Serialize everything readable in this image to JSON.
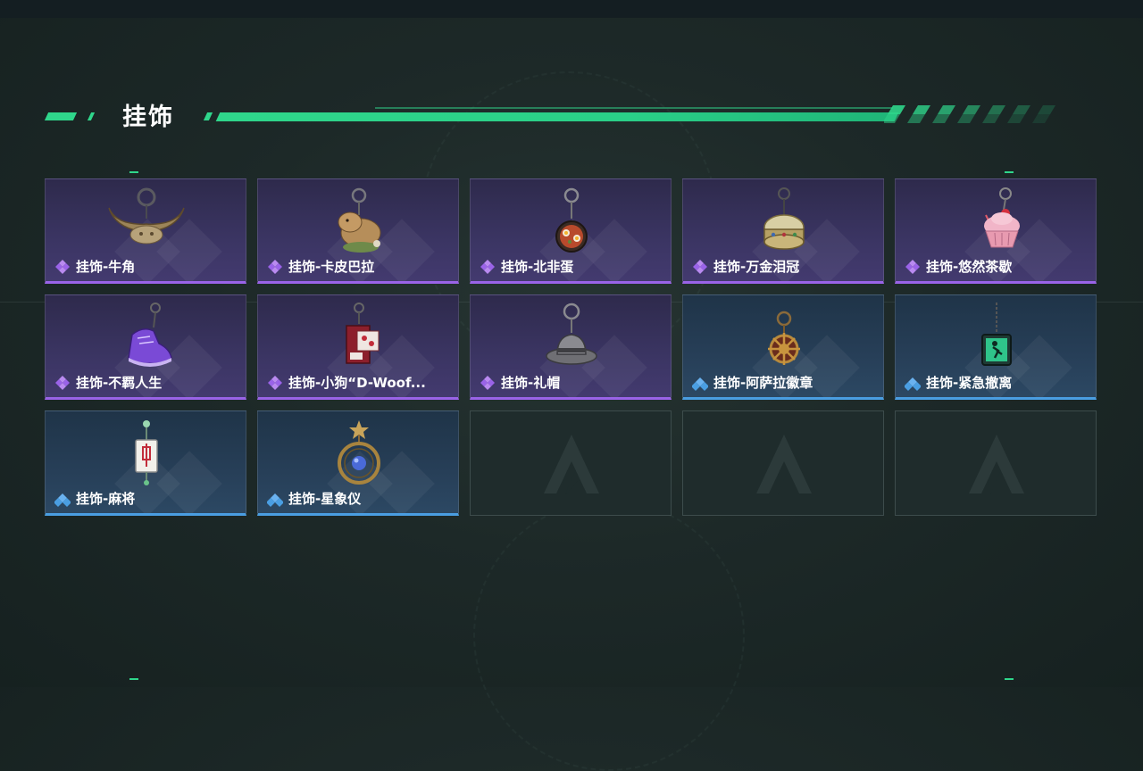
{
  "section": {
    "title": "挂饰"
  },
  "items": [
    {
      "label": "挂饰-牛角",
      "rarity": "purple",
      "icon": "horns-charm-icon"
    },
    {
      "label": "挂饰-卡皮巴拉",
      "rarity": "purple",
      "icon": "capybara-charm-icon"
    },
    {
      "label": "挂饰-北非蛋",
      "rarity": "purple",
      "icon": "shakshuka-charm-icon"
    },
    {
      "label": "挂饰-万金泪冠",
      "rarity": "purple",
      "icon": "crown-charm-icon"
    },
    {
      "label": "挂饰-悠然茶歇",
      "rarity": "purple",
      "icon": "cupcake-charm-icon"
    },
    {
      "label": "挂饰-不羁人生",
      "rarity": "purple",
      "icon": "sneaker-charm-icon"
    },
    {
      "label": "挂饰-小狗“D-Woof...",
      "rarity": "purple",
      "icon": "dog-box-charm-icon"
    },
    {
      "label": "挂饰-礼帽",
      "rarity": "purple",
      "icon": "fedora-charm-icon"
    },
    {
      "label": "挂饰-阿萨拉徽章",
      "rarity": "blue",
      "icon": "wheel-badge-charm-icon"
    },
    {
      "label": "挂饰-紧急撤离",
      "rarity": "blue",
      "icon": "exit-sign-charm-icon"
    },
    {
      "label": "挂饰-麻将",
      "rarity": "blue",
      "icon": "mahjong-tile-charm-icon"
    },
    {
      "label": "挂饰-星象仪",
      "rarity": "blue",
      "icon": "astrolabe-charm-icon"
    },
    {
      "rarity": "empty",
      "icon": "game-logo-icon"
    },
    {
      "rarity": "empty",
      "icon": "game-logo-icon"
    },
    {
      "rarity": "empty",
      "icon": "game-logo-icon"
    }
  ],
  "colors": {
    "accent": "#2fd68b",
    "purple": "#9a63e8",
    "blue": "#4a9ee2"
  }
}
